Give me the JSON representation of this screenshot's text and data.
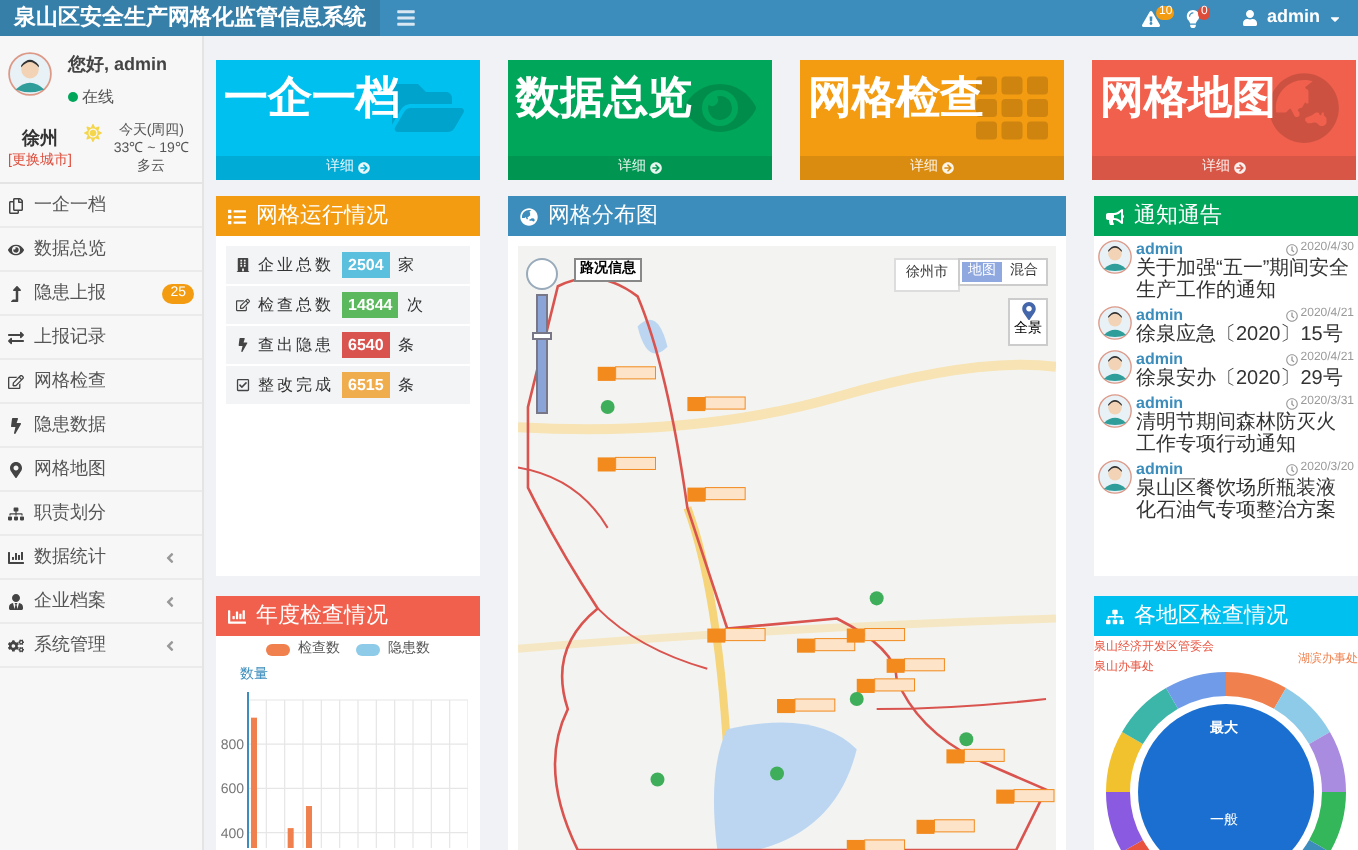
{
  "header": {
    "title": "泉山区安全生产网格化监管信息系统",
    "alerts": [
      {
        "kind": "warning",
        "badge": "10"
      },
      {
        "kind": "bulb",
        "badge": "0"
      }
    ],
    "user": "admin"
  },
  "sidebar": {
    "greeting": "您好, admin",
    "status": "在线",
    "city": "徐州",
    "change_city": "[更换城市]",
    "weather": {
      "day": "今天(周四)",
      "temp": "33℃ ~ 19℃",
      "sky": "多云"
    },
    "items": [
      {
        "label": "一企一档"
      },
      {
        "label": "数据总览"
      },
      {
        "label": "隐患上报",
        "badge": "25"
      },
      {
        "label": "上报记录"
      },
      {
        "label": "网格检查"
      },
      {
        "label": "隐患数据"
      },
      {
        "label": "网格地图"
      },
      {
        "label": "职责划分"
      },
      {
        "label": "数据统计",
        "expandable": true
      },
      {
        "label": "企业档案",
        "expandable": true
      },
      {
        "label": "系统管理",
        "expandable": true
      }
    ]
  },
  "tiles": [
    {
      "title": "一企一档",
      "kind": "folder",
      "color": "#00c0ef",
      "link": "详细"
    },
    {
      "title": "数据总览",
      "kind": "eye",
      "color": "#00a65a",
      "link": "详细"
    },
    {
      "title": "网格检查",
      "kind": "grid",
      "color": "#f39c12",
      "link": "详细"
    },
    {
      "title": "网格地图",
      "kind": "globe",
      "color": "#f0604d",
      "link": "详细"
    }
  ],
  "grid_status": {
    "title": "网格运行情况",
    "rows": [
      {
        "label": "企业总数",
        "value": "2504",
        "unit": "家",
        "color": "#5bc0de"
      },
      {
        "label": "检查总数",
        "value": "14844",
        "unit": "次",
        "color": "#5cb85c"
      },
      {
        "label": "查出隐患",
        "value": "6540",
        "unit": "条",
        "color": "#d9534f"
      },
      {
        "label": "整改完成",
        "value": "6515",
        "unit": "条",
        "color": "#f0ad4e"
      }
    ]
  },
  "annual": {
    "title": "年度检查情况",
    "chart_data": {
      "type": "bar",
      "ylabel": "数量",
      "series": [
        {
          "name": "检查数",
          "color": "#f0804d",
          "values": [
            920,
            null,
            420,
            520,
            null,
            null,
            null,
            null,
            null,
            null,
            null,
            null
          ]
        },
        {
          "name": "隐患数",
          "color": "#8ecbe8",
          "values": [
            null,
            null,
            null,
            null,
            null,
            null,
            null,
            null,
            null,
            null,
            null,
            null
          ]
        }
      ],
      "ylim": [
        330,
        1000
      ],
      "yticks": [
        400,
        600,
        800
      ],
      "grid": true
    }
  },
  "map": {
    "title": "网格分布图",
    "traffic": "路况信息",
    "city": "徐州市",
    "zoom": {
      "level": 0.65
    },
    "modes": [
      {
        "label": "地图",
        "selected": true
      },
      {
        "label": "混合",
        "selected": false
      }
    ],
    "panorama": "全景"
  },
  "notices": {
    "title": "通知通告",
    "items": [
      {
        "author": "admin",
        "date": "2020/4/30",
        "text": "关于加强“五一”期间安全生产工作的通知"
      },
      {
        "author": "admin",
        "date": "2020/4/21",
        "text": "徐泉应急〔2020〕15号"
      },
      {
        "author": "admin",
        "date": "2020/4/21",
        "text": "徐泉安办〔2020〕29号"
      },
      {
        "author": "admin",
        "date": "2020/3/31",
        "text": "清明节期间森林防灭火工作专项行动通知"
      },
      {
        "author": "admin",
        "date": "2020/3/20",
        "text": "泉山区餐饮场所瓶装液化石油气专项整治方案"
      }
    ]
  },
  "regions": {
    "title": "各地区检查情况",
    "labels_left": [
      "泉山经济开发区管委会",
      "泉山办事处"
    ],
    "labels_right": [
      "湖滨办事处"
    ],
    "center_top": "最大",
    "center_bottom": "一般"
  }
}
